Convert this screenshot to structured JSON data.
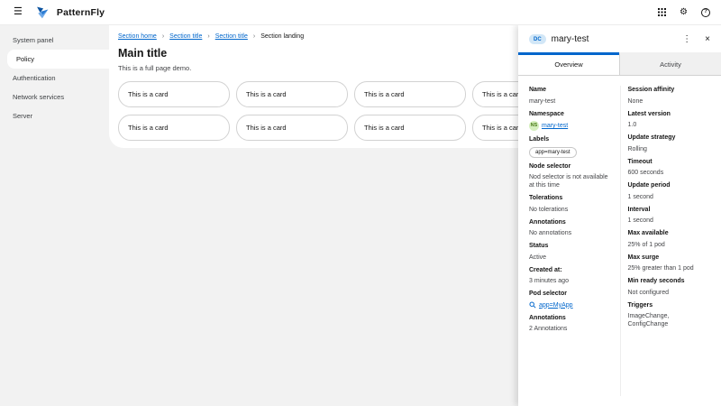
{
  "header": {
    "brand": "PatternFly"
  },
  "icons": {
    "menu": "☰",
    "gear": "⚙",
    "help": "?",
    "kebab": "⋮",
    "close": "×",
    "breadcrumb_separator": "›",
    "apps": "grid-icon",
    "pod_search": "magnifier-icon",
    "logo": "patternfly-fly-icon"
  },
  "sidebar": {
    "items": [
      {
        "label": "System panel"
      },
      {
        "label": "Policy",
        "active": true
      },
      {
        "label": "Authentication"
      },
      {
        "label": "Network services"
      },
      {
        "label": "Server"
      }
    ]
  },
  "breadcrumb": {
    "items": [
      {
        "label": "Section home"
      },
      {
        "label": "Section title"
      },
      {
        "label": "Section title"
      },
      {
        "label": "Section landing",
        "current": true
      }
    ]
  },
  "main": {
    "title": "Main title",
    "subtitle": "This is a full page demo.",
    "card_label": "This is a card",
    "card_count": 8
  },
  "drawer": {
    "resource_badge": "DC",
    "title": "mary-test",
    "tabs": [
      {
        "label": "Overview",
        "active": true
      },
      {
        "label": "Activity"
      }
    ],
    "details_left": {
      "name": {
        "term": "Name",
        "value": "mary-test"
      },
      "namespace": {
        "term": "Namespace",
        "badge": "NS",
        "value": "mary-test"
      },
      "labels": {
        "term": "Labels",
        "value": "app=mary-test"
      },
      "node_selector": {
        "term": "Node selector",
        "value": "Nod selector is not available at this time"
      },
      "tolerations": {
        "term": "Tolerations",
        "value": "No tolerations"
      },
      "annotations": {
        "term": "Annotations",
        "value": "No annotations"
      },
      "status": {
        "term": "Status",
        "value": "Active"
      },
      "created_at": {
        "term": "Created at:",
        "value": "3 minutes ago"
      },
      "pod_selector": {
        "term": "Pod selector",
        "value": "app=MyApp"
      },
      "annotations_count": {
        "term": "Annotations",
        "value": "2 Annotations"
      }
    },
    "details_right": {
      "session_affinity": {
        "term": "Session affinity",
        "value": "None"
      },
      "latest_version": {
        "term": "Latest version",
        "value": "1.0"
      },
      "update_strategy": {
        "term": "Update strategy",
        "value": "Rolling"
      },
      "timeout": {
        "term": "Timeout",
        "value": "600 seconds"
      },
      "update_period": {
        "term": "Update period",
        "value": "1 second"
      },
      "interval": {
        "term": "Interval",
        "value": "1 second"
      },
      "max_available": {
        "term": "Max available",
        "value": "25% of 1 pod"
      },
      "max_surge": {
        "term": "Max surge",
        "value": "25% greater than 1 pod"
      },
      "min_ready_seconds": {
        "term": "Min ready seconds",
        "value": "Not configured"
      },
      "triggers": {
        "term": "Triggers",
        "value": "ImageChange, ConfigChange"
      }
    }
  },
  "colors": {
    "accent": "#0066cc",
    "link": "#0066cc",
    "page_bg": "#f2f2f2",
    "panel_bg": "#ffffff",
    "border": "#d2d2d2",
    "badge_dc_bg": "#d2e7f7",
    "badge_dc_text": "#0066cc",
    "badge_ns_bg": "#d5efbe",
    "badge_ns_text": "#4d7c1b"
  }
}
